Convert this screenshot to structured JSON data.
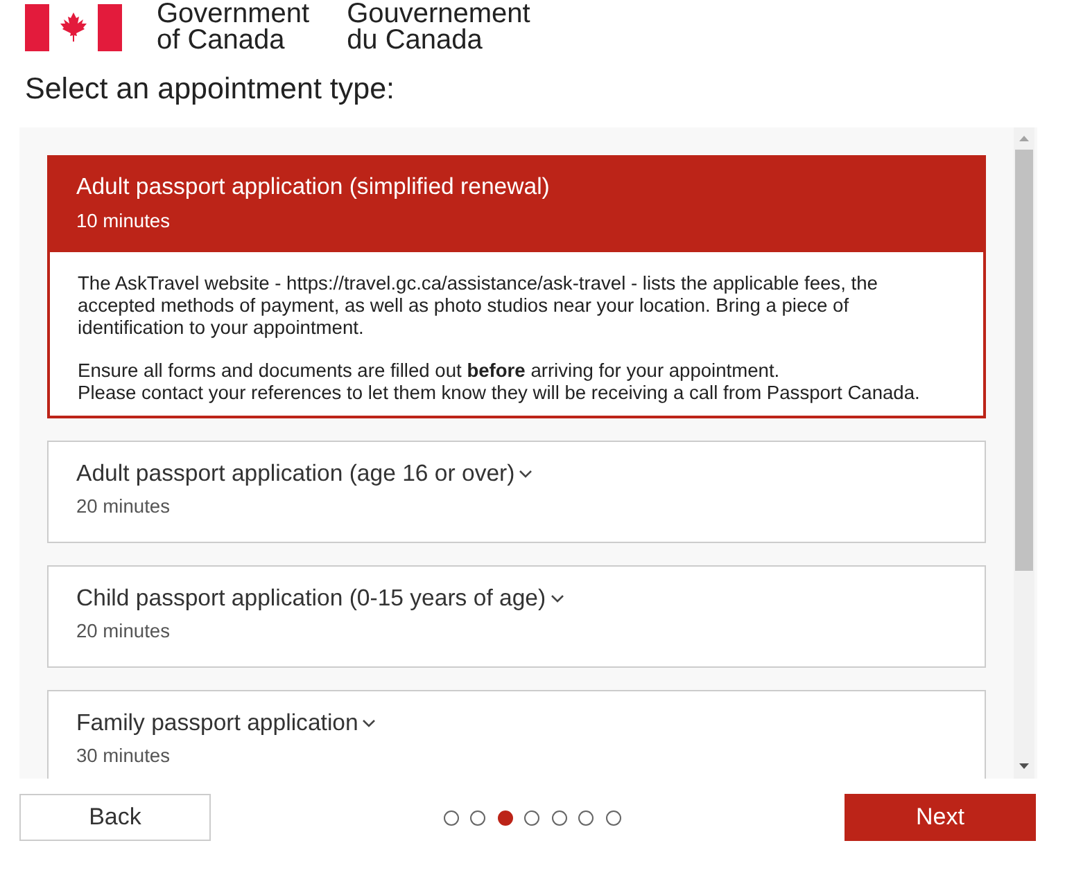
{
  "header": {
    "wordmark_en": [
      "Government",
      "of Canada"
    ],
    "wordmark_fr": [
      "Gouvernement",
      "du Canada"
    ]
  },
  "heading": "Select an appointment type:",
  "appointment_types": [
    {
      "title": "Adult passport application (simplified renewal)",
      "duration": "10 minutes",
      "selected": true,
      "expanded": true,
      "details": [
        [
          "The AskTravel website - https://travel.gc.ca/assistance/ask-travel - lists the applicable fees, the accepted methods of payment, as well as photo studios near your location. Bring a piece of identification to your appointment."
        ],
        [
          "Ensure all forms and documents are filled out **before** arriving for your appointment.",
          "Please contact your references to let them know they will be receiving a call from Passport Canada."
        ]
      ]
    },
    {
      "title": "Adult passport application (age 16 or over)",
      "duration": "20 minutes",
      "selected": false,
      "expanded": false
    },
    {
      "title": "Child passport application (0-15 years of age)",
      "duration": "20 minutes",
      "selected": false,
      "expanded": false
    },
    {
      "title": "Family passport application",
      "duration": "30 minutes",
      "selected": false,
      "expanded": false
    }
  ],
  "pager": [
    {
      "selected": false
    },
    {
      "selected": false
    },
    {
      "selected": true
    },
    {
      "selected": false
    },
    {
      "selected": false
    },
    {
      "selected": false
    },
    {
      "selected": false
    }
  ],
  "buttons": {
    "back": "Back",
    "next": "Next"
  }
}
